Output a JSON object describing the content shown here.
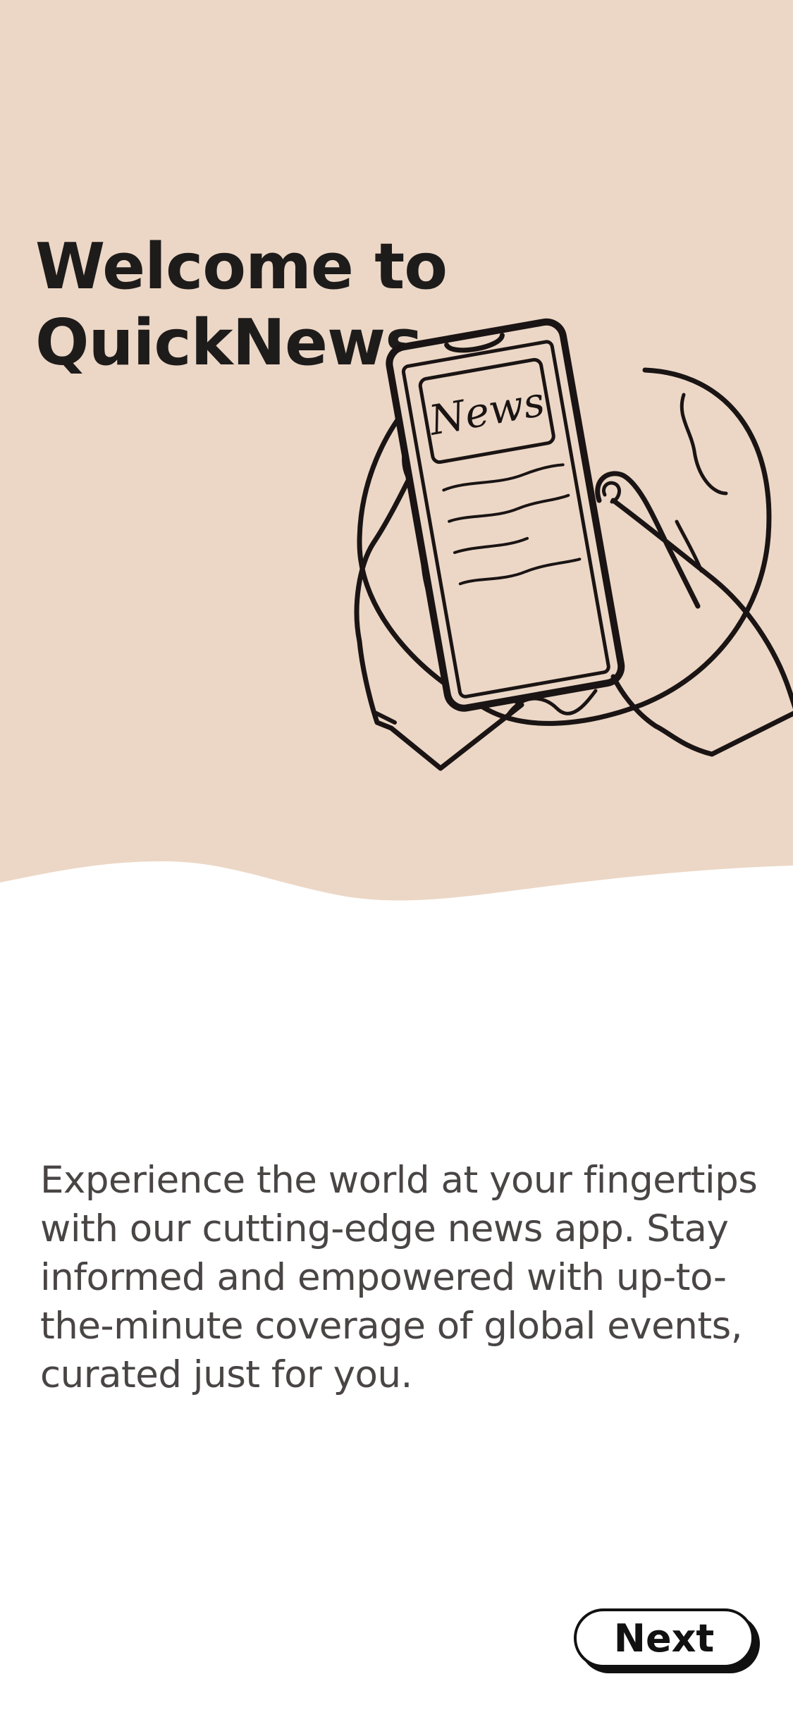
{
  "onboarding": {
    "title_line1": "Welcome to",
    "title_line2": "QuickNews",
    "illustration_screen_text": "News",
    "description": "Experience the world at your fingertips with our cutting-edge news app. Stay informed and empowered with up-to-the-minute coverage of global events, curated just for you.",
    "next_label": "Next"
  },
  "colors": {
    "hero_background": "#ecd7c6",
    "text_dark": "#1e1b1b",
    "text_body": "#4a4545",
    "line_art": "#1a1414"
  }
}
